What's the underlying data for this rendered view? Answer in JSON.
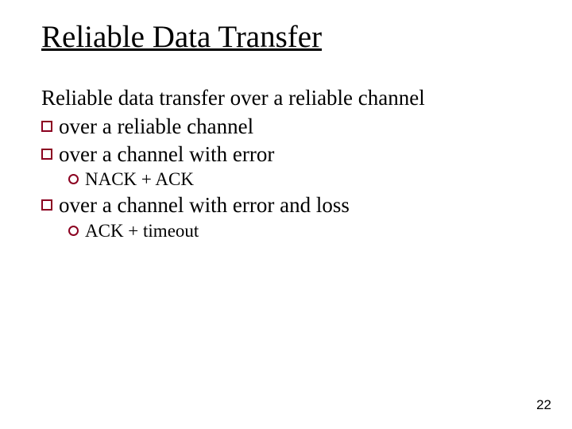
{
  "title": "Reliable Data Transfer",
  "subhead": "Reliable data transfer over a reliable channel",
  "bullets": {
    "b1": "over a reliable channel",
    "b2": "over a channel with error",
    "b2_1": "NACK + ACK",
    "b3": "over a channel with error and loss",
    "b3_1": "ACK + timeout"
  },
  "page_number": "22"
}
